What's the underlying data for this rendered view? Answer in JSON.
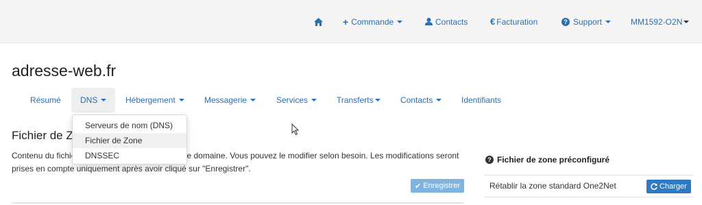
{
  "topnav": {
    "commande": "Commande",
    "contacts": "Contacts",
    "facturation": "Facturation",
    "support": "Support",
    "account": "MM1592-O2N"
  },
  "site": {
    "title": "adresse-web.fr"
  },
  "tabs": [
    "Résumé",
    "DNS",
    "Hébergement",
    "Messagerie",
    "Services",
    "Transferts",
    "Contacts",
    "Identifiants"
  ],
  "dns_menu": [
    "Serveurs de nom (DNS)",
    "Fichier de Zone",
    "DNSSEC"
  ],
  "section": {
    "title": "Fichier de Zone",
    "description": "Contenu du fichier de zone DNS de votre nom de domaine. Vous pouvez le modifier selon besoin. Les modifications seront prises en compte uniquement après avoir cliqué sur \"Enregistrer\".",
    "save_label": "Enregistrer"
  },
  "panel": {
    "title": "Fichier de zone préconfiguré",
    "row_text": "Rétablir la zone standard One2Net",
    "load_label": "Charger"
  },
  "colors": {
    "link": "#2a6fb0",
    "primary_button": "#2f7ac0",
    "disabled_button": "#7fb3e0"
  }
}
